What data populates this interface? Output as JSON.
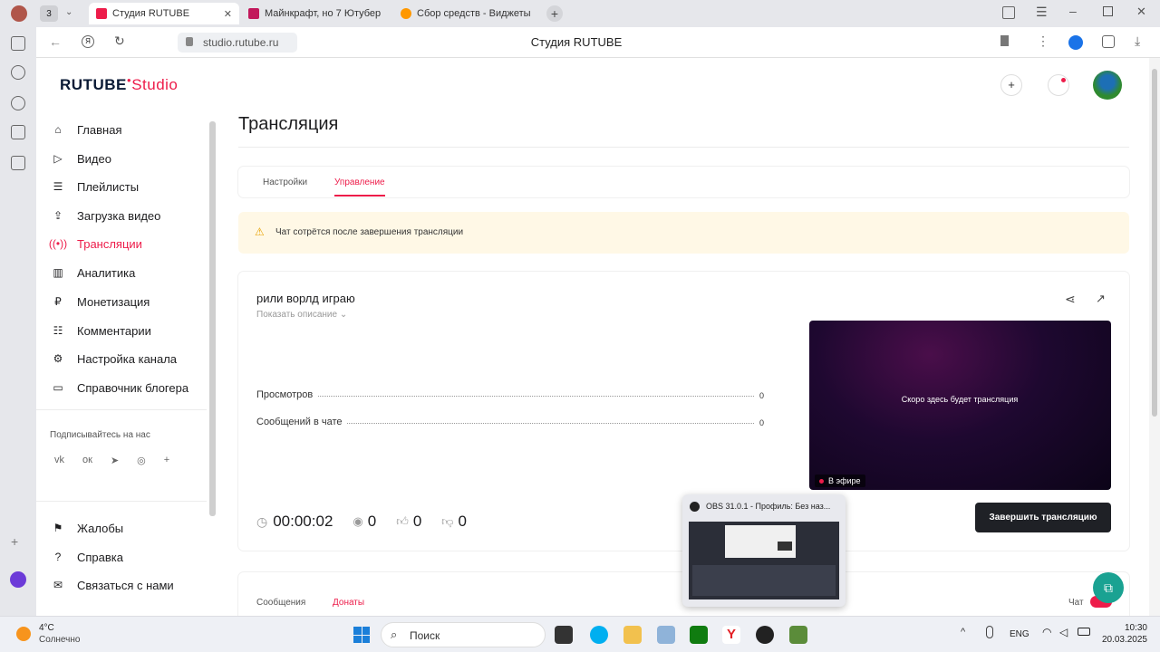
{
  "browser": {
    "tab_count": "3",
    "tabs": [
      {
        "title": "Студия RUTUBE",
        "active": true
      },
      {
        "title": "Майнкрафт, но 7 Ютубер"
      },
      {
        "title": "Сбор средств - Виджеты"
      }
    ],
    "url": "studio.rutube.ru",
    "page_title": "Студия RUTUBE"
  },
  "brand": {
    "logo": "RUTUBE",
    "logo_sub": "Studio",
    "accent": "#ed1c4a",
    "logo_dark": "#0a1a35"
  },
  "sidebar": {
    "items": [
      {
        "label": "Главная",
        "icon": "home-icon"
      },
      {
        "label": "Видео",
        "icon": "video-icon"
      },
      {
        "label": "Плейлисты",
        "icon": "playlist-icon"
      },
      {
        "label": "Загрузка видео",
        "icon": "upload-icon"
      },
      {
        "label": "Трансляции",
        "icon": "broadcast-icon",
        "active": true
      },
      {
        "label": "Аналитика",
        "icon": "analytics-icon"
      },
      {
        "label": "Монетизация",
        "icon": "money-icon"
      },
      {
        "label": "Комментарии",
        "icon": "comments-icon"
      },
      {
        "label": "Настройка канала",
        "icon": "gear-icon"
      },
      {
        "label": "Справочник блогера",
        "icon": "book-icon"
      }
    ],
    "subscribe_label": "Подписывайтесь на нас",
    "bottom_items": [
      {
        "label": "Жалобы",
        "icon": "flag-icon"
      },
      {
        "label": "Справка",
        "icon": "help-icon"
      },
      {
        "label": "Связаться с нами",
        "icon": "mail-icon"
      }
    ]
  },
  "main": {
    "title": "Трансляция",
    "tabs": [
      {
        "label": "Настройки"
      },
      {
        "label": "Управление",
        "active": true
      }
    ],
    "warning": "Чат сотрётся после завершения трансляции",
    "stream": {
      "title": "рили ворлд играю",
      "show_description": "Показать описание",
      "stats": [
        {
          "label": "Просмотров",
          "value": "0"
        },
        {
          "label": "Сообщений в чате",
          "value": "0"
        }
      ],
      "timer": "00:00:02",
      "viewers": "0",
      "likes": "0",
      "dislikes": "0",
      "preview_text": "Скоро здесь будет трансляция",
      "live_badge": "В эфире",
      "end_button": "Завершить трансляцию"
    },
    "bottom_tabs": [
      {
        "label": "Сообщения"
      },
      {
        "label": "Донаты",
        "active": true
      }
    ],
    "chat_toggle_label": "Чат"
  },
  "obs_thumbnail": {
    "title": "OBS 31.0.1 - Профиль: Без наз..."
  },
  "taskbar": {
    "weather_temp": "4°C",
    "weather_desc": "Солнечно",
    "search_placeholder": "Поиск",
    "lang": "ENG",
    "time": "10:30",
    "date": "20.03.2025"
  }
}
